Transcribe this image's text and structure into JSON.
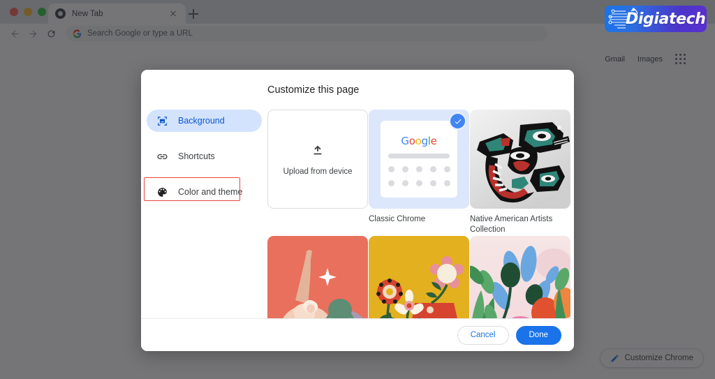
{
  "window": {
    "traffic_lights": [
      "close",
      "minimize",
      "maximize"
    ]
  },
  "tabstrip": {
    "tab_title": "New Tab",
    "close_icon": "close-icon",
    "new_tab_icon": "plus-icon"
  },
  "toolbar": {
    "back_icon": "back-arrow-icon",
    "forward_icon": "forward-arrow-icon",
    "reload_icon": "reload-icon",
    "omnibox_placeholder": "Search Google or type a URL",
    "omnibox_favicon": "google-g-icon"
  },
  "logo": {
    "text": "igiatech",
    "lead_letter": "D",
    "gradient_from": "#1a73e8",
    "gradient_to": "#5b2fd1"
  },
  "ntp": {
    "links": [
      {
        "label": "Gmail",
        "name": "gmail-link"
      },
      {
        "label": "Images",
        "name": "images-link"
      }
    ],
    "apps_icon": "apps-grid-icon",
    "customize_button": {
      "label": "Customize Chrome",
      "icon": "pencil-icon"
    }
  },
  "dialog": {
    "title": "Customize this page",
    "sidebar": [
      {
        "label": "Background",
        "icon": "image-frame-icon",
        "active": true,
        "highlight": false
      },
      {
        "label": "Shortcuts",
        "icon": "link-chain-icon",
        "active": false,
        "highlight": false
      },
      {
        "label": "Color and theme",
        "icon": "palette-icon",
        "active": false,
        "highlight": true
      }
    ],
    "highlight_color": "#e8453c",
    "accent_color": "#1a73e8",
    "selected_chip_bg": "#d3e3fd",
    "upload_tile": {
      "label": "Upload from device",
      "icon": "upload-icon"
    },
    "themes": [
      {
        "label": "Classic Chrome",
        "art": "classic-chrome-preview",
        "selected": true,
        "google_letters": [
          "G",
          "o",
          "o",
          "g",
          "l",
          "e"
        ]
      },
      {
        "label": "Native American Artists Collection",
        "art": "native-american-formline-art",
        "selected": false
      },
      {
        "label": "",
        "art": "coral-figures-illustration",
        "selected": false
      },
      {
        "label": "",
        "art": "yellow-flowers-illustration",
        "selected": false
      },
      {
        "label": "",
        "art": "pastel-plants-illustration",
        "selected": false
      }
    ],
    "footer": {
      "cancel_label": "Cancel",
      "done_label": "Done"
    }
  }
}
